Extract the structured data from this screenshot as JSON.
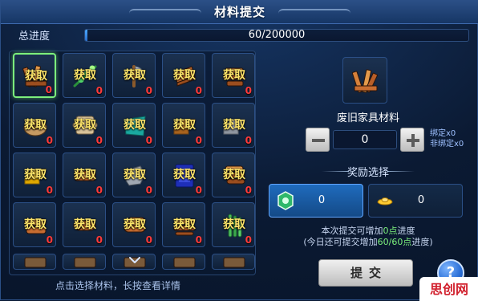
{
  "window": {
    "title": "材料提交"
  },
  "progress": {
    "label": "总进度",
    "text": "60/200000",
    "current": 60,
    "max": 200000
  },
  "grid": {
    "slots": [
      {
        "row": 0,
        "col": 0,
        "icon": "broken-furniture-icon",
        "action": "获取",
        "count": "0",
        "selected": true
      },
      {
        "row": 0,
        "col": 1,
        "icon": "herb-branch-icon",
        "action": "获取",
        "count": "0"
      },
      {
        "row": 0,
        "col": 2,
        "icon": "axe-icon",
        "action": "获取",
        "count": "0"
      },
      {
        "row": 0,
        "col": 3,
        "icon": "wood-chunk-icon",
        "action": "获取",
        "count": "0"
      },
      {
        "row": 0,
        "col": 4,
        "icon": "wood-bundle-icon",
        "action": "获取",
        "count": "0"
      },
      {
        "row": 1,
        "col": 0,
        "icon": "nest-icon",
        "action": "获取",
        "count": "0"
      },
      {
        "row": 1,
        "col": 1,
        "icon": "scroll-icon",
        "action": "获取",
        "count": "0"
      },
      {
        "row": 1,
        "col": 2,
        "icon": "cloth-icon",
        "action": "获取",
        "count": "0"
      },
      {
        "row": 1,
        "col": 3,
        "icon": "bronze-ingot-icon",
        "action": "获取",
        "count": "0"
      },
      {
        "row": 1,
        "col": 4,
        "icon": "silver-ingot-icon",
        "action": "获取",
        "count": "0"
      },
      {
        "row": 2,
        "col": 0,
        "icon": "gold-bar-icon",
        "action": "获取",
        "count": "0"
      },
      {
        "row": 2,
        "col": 1,
        "icon": "plank-icon",
        "action": "获取",
        "count": "0"
      },
      {
        "row": 2,
        "col": 2,
        "icon": "stone-icon",
        "action": "获取",
        "count": "0"
      },
      {
        "row": 2,
        "col": 3,
        "icon": "blue-book-icon",
        "action": "获取",
        "count": "0"
      },
      {
        "row": 2,
        "col": 4,
        "icon": "logs-icon",
        "action": "获取",
        "count": "0"
      },
      {
        "row": 3,
        "col": 0,
        "icon": "wood-plank-icon",
        "action": "获取",
        "count": "0"
      },
      {
        "row": 3,
        "col": 1,
        "icon": "log-icon",
        "action": "获取",
        "count": "0"
      },
      {
        "row": 3,
        "col": 2,
        "icon": "log-pile-icon",
        "action": "获取",
        "count": "0"
      },
      {
        "row": 3,
        "col": 3,
        "icon": "timber-icon",
        "action": "获取",
        "count": "0"
      },
      {
        "row": 3,
        "col": 4,
        "icon": "bamboo-icon",
        "action": "获取",
        "count": "0"
      }
    ],
    "partial_row": [
      {
        "col": 0,
        "icon": "item-icon"
      },
      {
        "col": 1,
        "icon": "item-icon"
      },
      {
        "col": 2,
        "icon": "item-icon"
      },
      {
        "col": 3,
        "icon": "item-icon"
      },
      {
        "col": 4,
        "icon": "item-icon"
      }
    ],
    "hint": "点击选择材料，长按查看详情"
  },
  "detail": {
    "icon": "broken-furniture-icon",
    "name": "废旧家具材料",
    "quantity": "0",
    "bound": "绑定x0",
    "unbound": "非绑定x0"
  },
  "rewards": {
    "title": "奖励选择",
    "options": [
      {
        "icon": "jade-token-icon",
        "value": "0",
        "active": true
      },
      {
        "icon": "gold-ingot-icon",
        "value": "0",
        "active": false
      }
    ],
    "note_prefix": "本次提交可增加",
    "note_points": "0点",
    "note_suffix": "进度",
    "note2_prefix": "(今日还可提交增加",
    "note2_points": "60/60点",
    "note2_suffix": "进度)"
  },
  "actions": {
    "submit": "提交",
    "help": "?"
  },
  "watermark": {
    "text": "思创网"
  },
  "colors": {
    "accent": "#62a7ff",
    "positive": "#7cf07c",
    "warning": "#ff3a3a",
    "action_text": "#ffe66a"
  }
}
